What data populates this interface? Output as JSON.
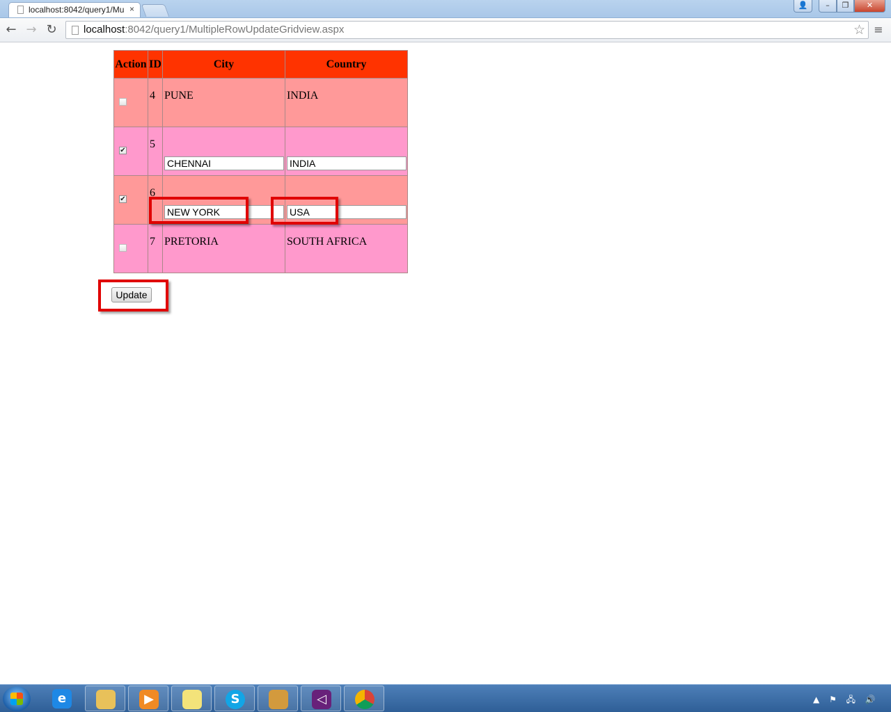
{
  "browser": {
    "tab_title": "localhost:8042/query1/Mu",
    "tab_close": "×",
    "url_host": "localhost",
    "url_rest": ":8042/query1/MultipleRowUpdateGridview.aspx",
    "back_glyph": "←",
    "forward_glyph": "→",
    "reload_glyph": "↻",
    "star_glyph": "☆",
    "menu_glyph": "≡",
    "window_controls": {
      "user": "👤",
      "minimize": "–",
      "maximize": "❐",
      "close": "✕"
    }
  },
  "grid": {
    "headers": {
      "action": "Action",
      "id": "ID",
      "city": "City",
      "country": "Country"
    },
    "header_color": "#ff3300",
    "row_colors": [
      "#ff9999",
      "#ff99cc"
    ],
    "rows": [
      {
        "checked": false,
        "id": "4",
        "city": "PUNE",
        "country": "INDIA",
        "editing": false
      },
      {
        "checked": true,
        "id": "5",
        "city": "CHENNAI",
        "country": "INDIA",
        "editing": true
      },
      {
        "checked": true,
        "id": "6",
        "city": "NEW YORK",
        "country": "USA",
        "editing": true
      },
      {
        "checked": false,
        "id": "7",
        "city": "PRETORIA",
        "country": "SOUTH AFRICA",
        "editing": false
      }
    ]
  },
  "update_button": {
    "label": "Update"
  },
  "highlight_color": "#e00000",
  "taskbar": {
    "apps": [
      "windows-explorer",
      "internet-explorer",
      "file-explorer",
      "media-player",
      "sticky-notes",
      "skype",
      "cleaner",
      "visual-studio",
      "chrome"
    ],
    "tray": {
      "up_arrow": "▲",
      "flag": "⚑",
      "network": "🖧",
      "volume": "🔊"
    }
  }
}
